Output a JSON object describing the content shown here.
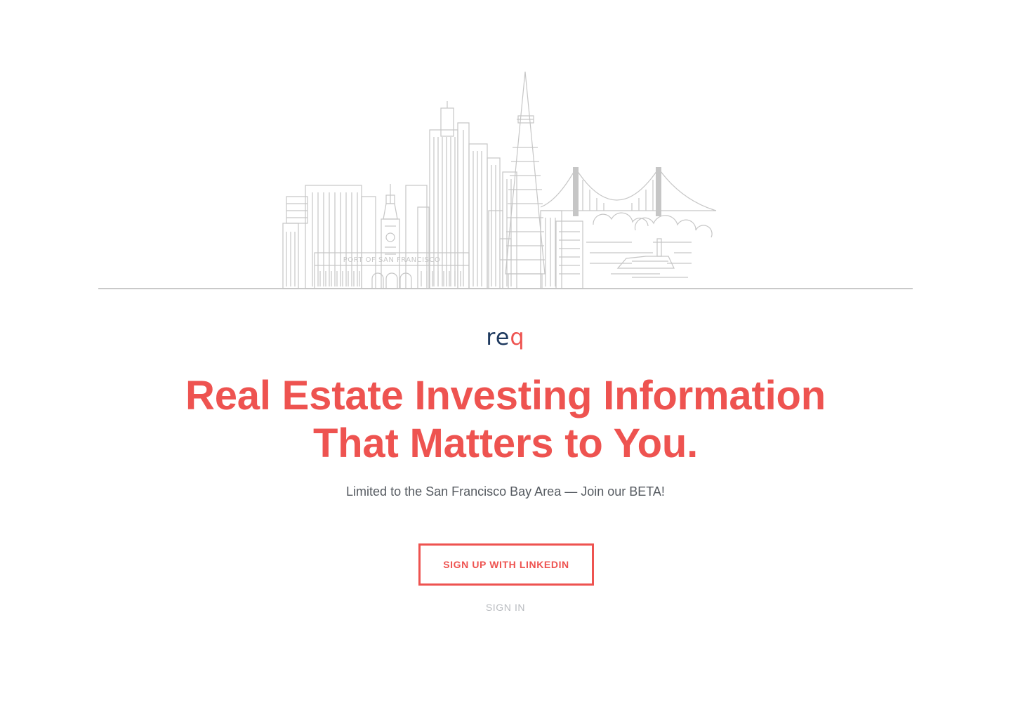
{
  "illustration": {
    "sign_text": "PORT OF SAN FRANCISCO"
  },
  "brand": {
    "logo_re": "re",
    "logo_q": "q",
    "primary_color": "#ee5350",
    "logo_color": "#1f3a5f"
  },
  "hero": {
    "headline_line1": "Real Estate Investing Information",
    "headline_line2": "That Matters to You.",
    "subtitle": "Limited to the San Francisco Bay Area — Join our BETA!"
  },
  "actions": {
    "signup_label": "SIGN UP WITH LINKEDIN",
    "signin_label": "SIGN IN"
  }
}
